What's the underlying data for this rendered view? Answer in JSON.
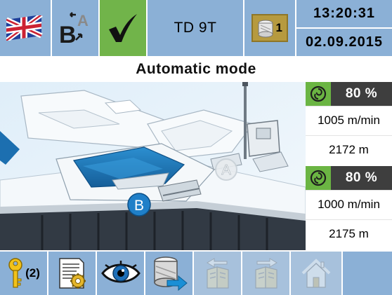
{
  "header": {
    "language_icon": "uk-flag-icon",
    "switch_icon": "switch-b-to-a-icon",
    "switch_letters": {
      "b": "B",
      "a": "A"
    },
    "status_icon": "green-checkmark-icon",
    "machine_name": "TD 9T",
    "counter_value": "1",
    "time": "13:20:31",
    "date": "02.09.2015"
  },
  "mode": {
    "title": "Automatic mode"
  },
  "machine_view": {
    "positions": [
      {
        "label": "A",
        "state": "inactive"
      },
      {
        "label": "B",
        "state": "active"
      }
    ]
  },
  "status": [
    {
      "efficiency": "80 %",
      "speed": "1005 m/min",
      "length": "2172 m"
    },
    {
      "efficiency": "80 %",
      "speed": "1000 m/min",
      "length": "2175 m"
    }
  ],
  "toolbar": {
    "access_level": "(2)",
    "buttons": [
      {
        "name": "key-access-button",
        "icon": "key-icon",
        "enabled": true
      },
      {
        "name": "settings-report-button",
        "icon": "document-gear-icon",
        "enabled": true
      },
      {
        "name": "view-button",
        "icon": "eye-icon",
        "enabled": true
      },
      {
        "name": "package-transfer-button",
        "icon": "package-arrow-icon",
        "enabled": true
      },
      {
        "name": "previous-page-button",
        "icon": "page-back-icon",
        "enabled": false
      },
      {
        "name": "next-page-button",
        "icon": "page-forward-icon",
        "enabled": false
      },
      {
        "name": "home-button",
        "icon": "home-icon",
        "enabled": false
      }
    ]
  },
  "colors": {
    "button_blue": "#8bb0d6",
    "ok_green": "#71b44a",
    "efficiency_green": "#6bb543",
    "efficiency_dark": "#3e3e3e",
    "counter_gold": "#b69a3f",
    "position_blue": "#1f7fc8"
  }
}
